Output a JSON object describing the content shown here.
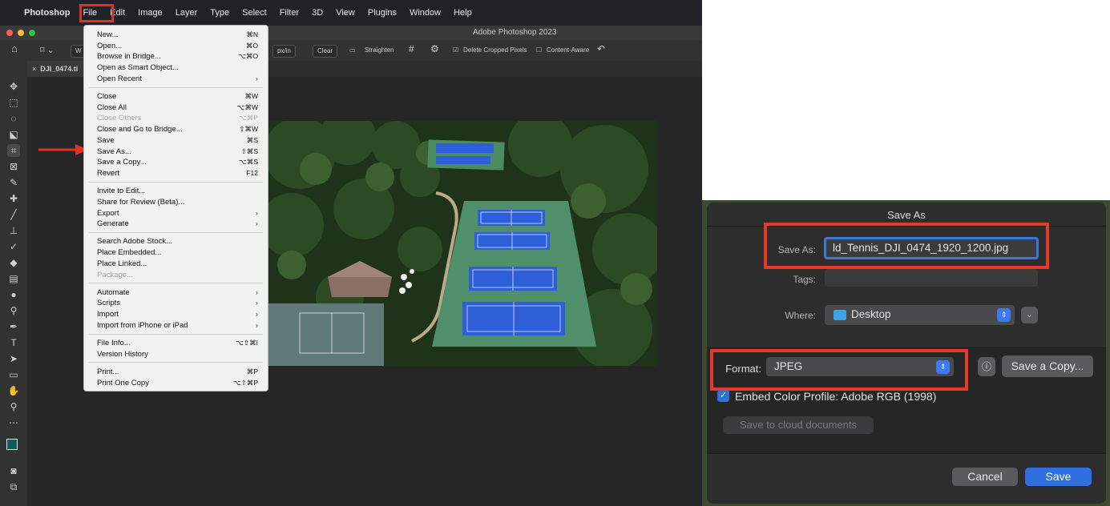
{
  "menubar": {
    "apple_icon": "",
    "items": [
      "Photoshop",
      "File",
      "Edit",
      "Image",
      "Layer",
      "Type",
      "Select",
      "Filter",
      "3D",
      "View",
      "Plugins",
      "Window",
      "Help"
    ]
  },
  "window": {
    "title": "Adobe Photoshop 2023"
  },
  "options_bar": {
    "tool_preset": "⌑ ⌄",
    "ratio": "W",
    "units": "px/in",
    "clear": "Clear",
    "straighten": "Straighten",
    "delete_cropped": "Delete Cropped Pixels",
    "content_aware": "Content-Aware"
  },
  "document_tab": {
    "name": "DJI_0474.ti"
  },
  "file_menu": {
    "groups": [
      [
        {
          "label": "New...",
          "shortcut": "⌘N",
          "disabled": false
        },
        {
          "label": "Open...",
          "shortcut": "⌘O",
          "disabled": false
        },
        {
          "label": "Browse in Bridge...",
          "shortcut": "⌥⌘O",
          "disabled": false
        },
        {
          "label": "Open as Smart Object...",
          "shortcut": "",
          "disabled": false
        },
        {
          "label": "Open Recent",
          "shortcut": "›",
          "disabled": false
        }
      ],
      [
        {
          "label": "Close",
          "shortcut": "⌘W",
          "disabled": false
        },
        {
          "label": "Close All",
          "shortcut": "⌥⌘W",
          "disabled": false
        },
        {
          "label": "Close Others",
          "shortcut": "⌥⌘P",
          "disabled": true
        },
        {
          "label": "Close and Go to Bridge...",
          "shortcut": "⇧⌘W",
          "disabled": false
        },
        {
          "label": "Save",
          "shortcut": "⌘S",
          "disabled": false
        },
        {
          "label": "Save As...",
          "shortcut": "⇧⌘S",
          "disabled": false
        },
        {
          "label": "Save a Copy...",
          "shortcut": "⌥⌘S",
          "disabled": false
        },
        {
          "label": "Revert",
          "shortcut": "F12",
          "disabled": false
        }
      ],
      [
        {
          "label": "Invite to Edit...",
          "shortcut": "",
          "disabled": false
        },
        {
          "label": "Share for Review (Beta)...",
          "shortcut": "",
          "disabled": false
        },
        {
          "label": "Export",
          "shortcut": "›",
          "disabled": false
        },
        {
          "label": "Generate",
          "shortcut": "›",
          "disabled": false
        }
      ],
      [
        {
          "label": "Search Adobe Stock...",
          "shortcut": "",
          "disabled": false
        },
        {
          "label": "Place Embedded...",
          "shortcut": "",
          "disabled": false
        },
        {
          "label": "Place Linked...",
          "shortcut": "",
          "disabled": false
        },
        {
          "label": "Package...",
          "shortcut": "",
          "disabled": true
        }
      ],
      [
        {
          "label": "Automate",
          "shortcut": "›",
          "disabled": false
        },
        {
          "label": "Scripts",
          "shortcut": "›",
          "disabled": false
        },
        {
          "label": "Import",
          "shortcut": "›",
          "disabled": false
        },
        {
          "label": "Import from iPhone or iPad",
          "shortcut": "›",
          "disabled": false
        }
      ],
      [
        {
          "label": "File Info...",
          "shortcut": "⌥⇧⌘I",
          "disabled": false
        },
        {
          "label": "Version History",
          "shortcut": "",
          "disabled": false
        }
      ],
      [
        {
          "label": "Print...",
          "shortcut": "⌘P",
          "disabled": false
        },
        {
          "label": "Print One Copy",
          "shortcut": "⌥⇧⌘P",
          "disabled": false
        }
      ]
    ]
  },
  "save_dialog": {
    "title": "Save As",
    "save_as_label": "Save As:",
    "filename": "ld_Tennis_DJI_0474_1920_1200.jpg",
    "tags_label": "Tags:",
    "where_label": "Where:",
    "where_value": "Desktop",
    "format_label": "Format:",
    "format_value": "JPEG",
    "save_copy_button": "Save a Copy...",
    "embed_label": "Embed Color Profile:",
    "embed_value": "Adobe RGB (1998)",
    "cloud_button": "Save to cloud documents",
    "cancel_button": "Cancel",
    "save_button": "Save"
  },
  "colors": {
    "highlight_red": "#e03222",
    "accent_blue": "#2f6fe0",
    "court_blue": "#2e5ed8",
    "court_green": "#4f8f6c"
  }
}
